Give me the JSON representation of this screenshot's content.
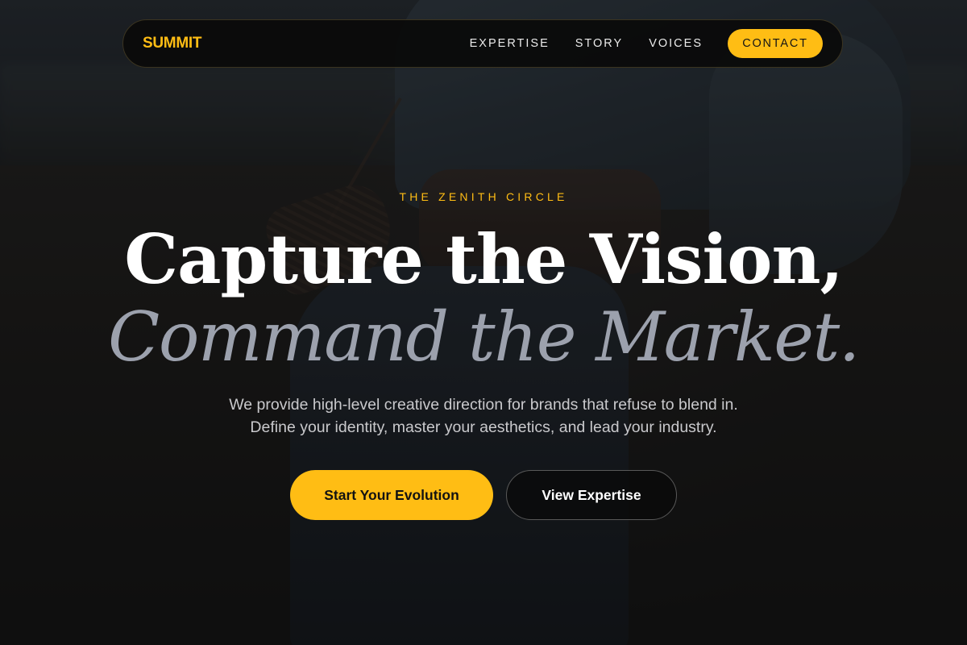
{
  "nav": {
    "logo": "SUMMIT",
    "links": [
      "EXPERTISE",
      "STORY",
      "VOICES"
    ],
    "contact_label": "CONTACT"
  },
  "hero": {
    "eyebrow": "THE ZENITH CIRCLE",
    "headline_line1": "Capture the Vision,",
    "headline_line2": "Command the Market.",
    "subtitle": "We provide high-level creative direction for brands that refuse to blend in. Define your identity, master your aesthetics, and lead your industry.",
    "primary_cta": "Start Your Evolution",
    "secondary_cta": "View Expertise"
  },
  "colors": {
    "accent": "#ffbd14",
    "background": "#0c0c0c",
    "headline": "#ffffff",
    "headline_muted": "#9ca1ad",
    "body_text": "#c9c9cc"
  },
  "background_image": "photo-of-person-in-denim-jacket-and-jeans"
}
